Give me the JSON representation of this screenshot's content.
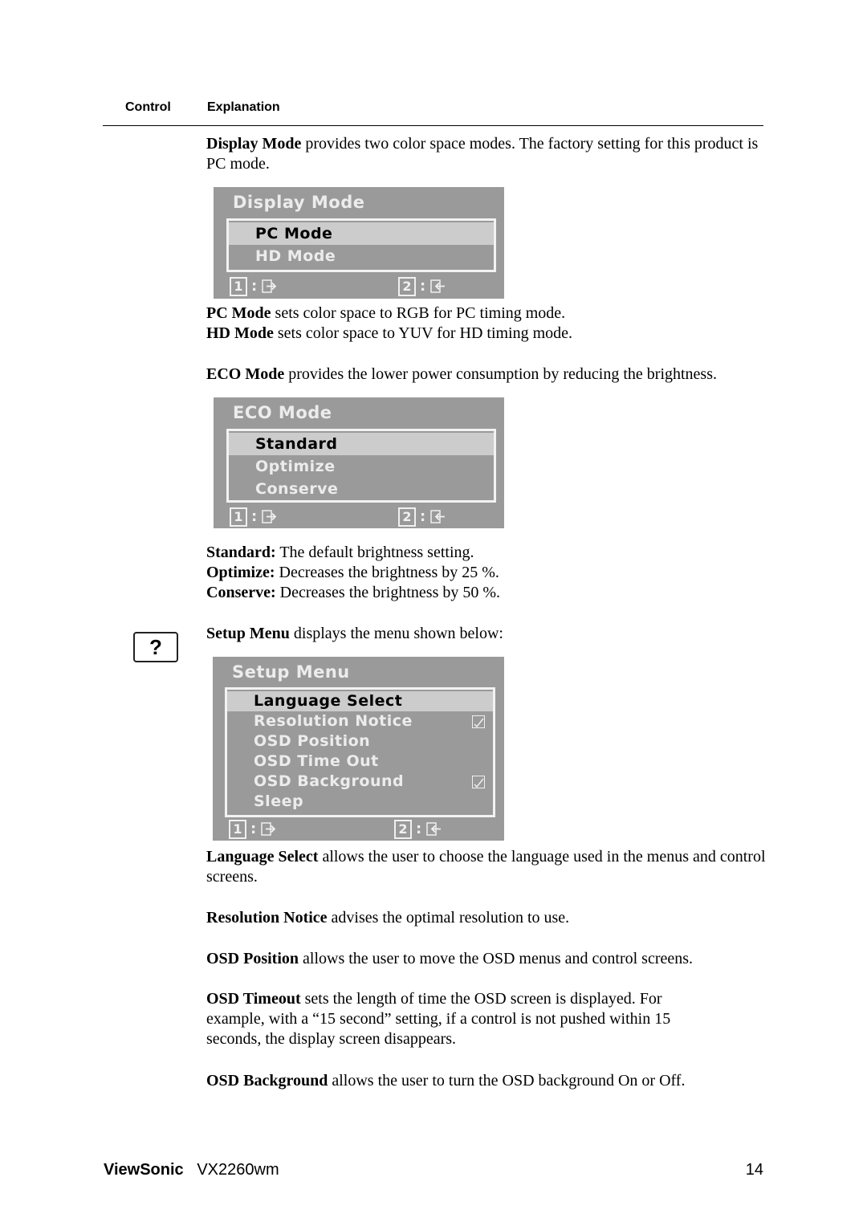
{
  "table_header": {
    "control": "Control",
    "explanation": "Explanation"
  },
  "display_mode": {
    "intro_bold": "Display Mode",
    "intro_text": " provides two color space modes. The factory setting for this product is PC mode.",
    "osd": {
      "title": "Display Mode",
      "items": [
        {
          "label": "PC Mode",
          "selected": true
        },
        {
          "label": "HD Mode",
          "selected": false
        }
      ],
      "footer": {
        "key1": "1",
        "key2": "2",
        "sep": ":",
        "key1_icon": "exit-right-icon",
        "key2_icon": "enter-left-icon"
      }
    },
    "notes": [
      {
        "bold": "PC Mode",
        "text": " sets color space to RGB for PC timing mode."
      },
      {
        "bold": "HD Mode",
        "text": " sets color space to YUV for HD timing mode."
      }
    ]
  },
  "eco_mode": {
    "intro_bold": "ECO Mode",
    "intro_text": " provides the lower power consumption by reducing the brightness.",
    "osd": {
      "title": "ECO Mode",
      "items": [
        {
          "label": "Standard",
          "selected": true
        },
        {
          "label": "Optimize",
          "selected": false
        },
        {
          "label": "Conserve",
          "selected": false
        }
      ],
      "footer": {
        "key1": "1",
        "key2": "2",
        "sep": ":"
      }
    },
    "notes": [
      {
        "bold": "Standard:",
        "text": " The default brightness setting."
      },
      {
        "bold": "Optimize:",
        "text": " Decreases the brightness by 25 %."
      },
      {
        "bold": "Conserve:",
        "text": " Decreases the brightness by 50 %."
      }
    ]
  },
  "setup_menu": {
    "control_icon": "?",
    "intro_bold": "Setup Menu",
    "intro_text": " displays the menu shown below:",
    "osd": {
      "title": "Setup Menu",
      "items": [
        {
          "label": "Language Select",
          "selected": true,
          "checked": false
        },
        {
          "label": "Resolution Notice",
          "selected": false,
          "checked": true
        },
        {
          "label": "OSD Position",
          "selected": false,
          "checked": false
        },
        {
          "label": "OSD Time Out",
          "selected": false,
          "checked": false
        },
        {
          "label": "OSD Background",
          "selected": false,
          "checked": true
        },
        {
          "label": "Sleep",
          "selected": false,
          "checked": false
        }
      ],
      "footer": {
        "key1": "1",
        "key2": "2",
        "sep": ":"
      }
    },
    "notes": [
      {
        "bold": "Language Select",
        "text": " allows the user to choose the language used in the menus and control screens."
      },
      {
        "bold": "Resolution Notice",
        "text": " advises the optimal resolution to use."
      },
      {
        "bold": "OSD Position",
        "text": " allows the user to move the OSD menus and control screens."
      },
      {
        "bold": "OSD Timeout",
        "text": " sets the length of time the OSD screen is displayed. For example, with a “15 second” setting, if a control is not pushed within 15 seconds, the display screen disappears."
      },
      {
        "bold": "OSD Background",
        "text": " allows the user to turn the OSD background On or Off."
      }
    ]
  },
  "footer": {
    "brand": "ViewSonic",
    "model": "VX2260wm",
    "page_number": "14"
  }
}
